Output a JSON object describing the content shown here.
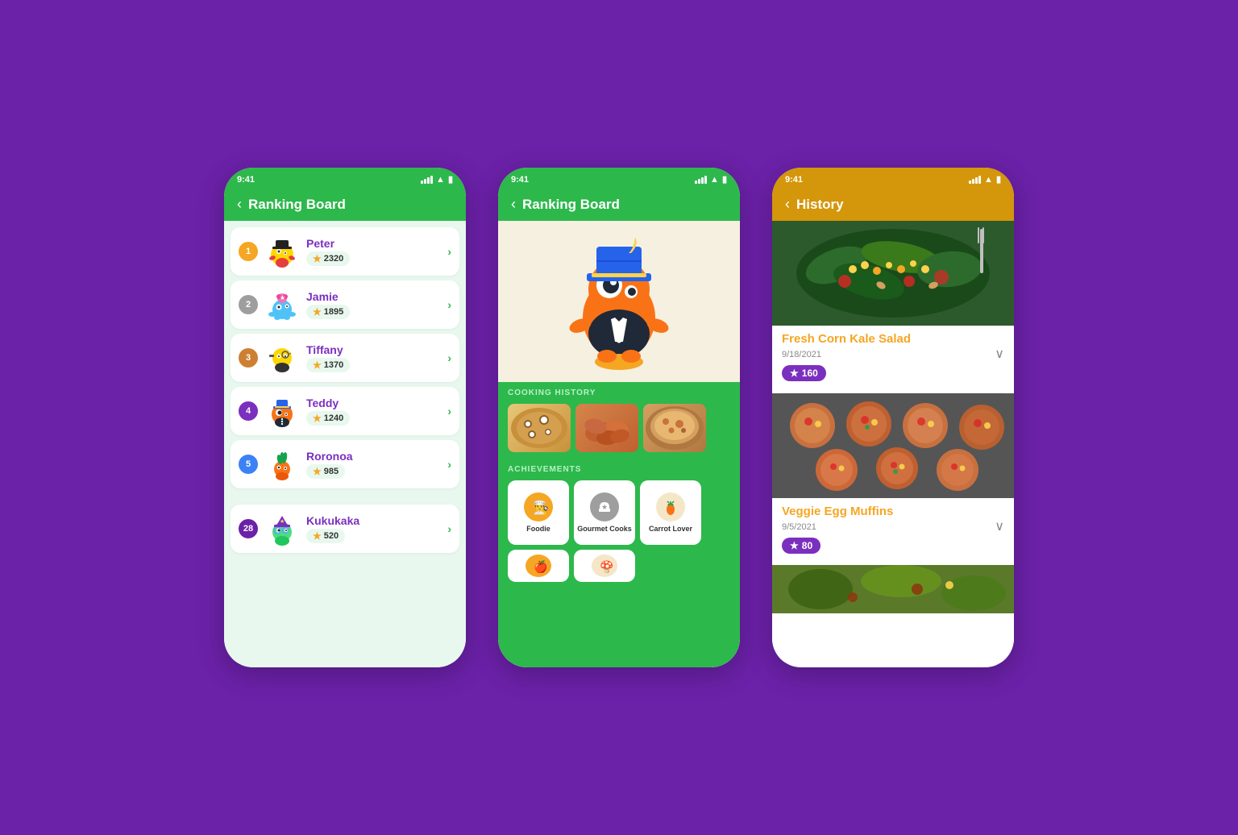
{
  "background": "#6B21A8",
  "phone1": {
    "status_time": "9:41",
    "header_title": "Ranking Board",
    "header_color": "green",
    "rankings": [
      {
        "rank": 1,
        "badge_class": "badge-gold",
        "name": "Peter",
        "score": "2320",
        "avatar": "🐱"
      },
      {
        "rank": 2,
        "badge_class": "badge-silver",
        "name": "Jamie",
        "score": "1895",
        "avatar": "🐙"
      },
      {
        "rank": 3,
        "badge_class": "badge-bronze",
        "name": "Tiffany",
        "score": "1370",
        "avatar": "🐛"
      },
      {
        "rank": 4,
        "badge_class": "badge-purple",
        "name": "Teddy",
        "score": "1240",
        "avatar": "🦡"
      },
      {
        "rank": 5,
        "badge_class": "badge-blue",
        "name": "Roronoa",
        "score": "985",
        "avatar": "🥕"
      }
    ],
    "current_user": {
      "rank": 28,
      "badge_class": "badge-dark-purple",
      "name": "Kukukaka",
      "score": "520",
      "avatar": "🧙"
    }
  },
  "phone2": {
    "status_time": "9:41",
    "header_title": "Ranking Board",
    "header_color": "green",
    "cooking_history_label": "COOKING HISTORY",
    "achievements_label": "ACHIEVEMENTS",
    "achievements": [
      {
        "name": "Foodie",
        "icon": "👨‍🍳",
        "icon_class": "badge-icon-gold"
      },
      {
        "name": "Gourmet Cooks",
        "icon": "⭐",
        "icon_class": "badge-icon-gray"
      },
      {
        "name": "Carrot Lover",
        "icon": "🥕",
        "icon_class": "badge-icon-cream"
      }
    ]
  },
  "phone3": {
    "status_time": "9:41",
    "header_title": "History",
    "header_color": "amber",
    "history_items": [
      {
        "title": "Fresh Corn Kale Salad",
        "date": "9/18/2021",
        "score": "160",
        "img_class": "food-img-salad"
      },
      {
        "title": "Veggie Egg Muffins",
        "date": "9/5/2021",
        "score": "80",
        "img_class": "food-img-muffins"
      }
    ]
  }
}
